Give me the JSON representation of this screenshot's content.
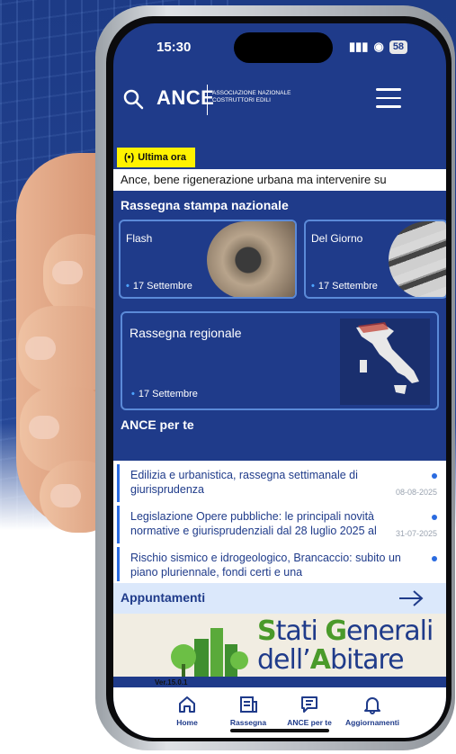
{
  "status_bar": {
    "time": "15:30",
    "signal": "▐▌",
    "battery": "58"
  },
  "header": {
    "logo": "ANCE",
    "logo_sub": "ASSOCIAZIONE NAZIONALE COSTRUTTORI EDILI",
    "icons": [
      "search-icon",
      "hamburger-menu-icon"
    ]
  },
  "breaking": {
    "badge_icon": "(•)",
    "badge_label": "Ultima ora",
    "ticker_text": "Ance, bene rigenerazione urbana ma intervenire su"
  },
  "rassegna": {
    "title": "Rassegna stampa nazionale",
    "cards": [
      {
        "label": "Flash",
        "date": "17 Settembre"
      },
      {
        "label": "Del Giorno",
        "date": "17 Settembre"
      }
    ],
    "regional": {
      "label": "Rassegna regionale",
      "date": "17 Settembre"
    }
  },
  "ance_per_te": {
    "title": "ANCE per te",
    "items": [
      {
        "text": "Edilizia e urbanistica, rassegna settimanale di giurisprudenza",
        "date": "08-08-2025"
      },
      {
        "text": "Legislazione Opere pubbliche: le principali novità normative e giurisprudenziali dal 28 luglio 2025 al",
        "date": "31-07-2025"
      },
      {
        "text": "Rischio sismico e idrogeologico, Brancaccio: subito un piano pluriennale, fondi certi e una",
        "date": ""
      }
    ]
  },
  "appuntamenti": {
    "title": "Appuntamenti",
    "icon": "arrow-right-icon"
  },
  "banner": {
    "line1_a": "S",
    "line1_b": "tati ",
    "line1_c": "G",
    "line1_d": "enerali",
    "line2_a": "dell’",
    "line2_b": "A",
    "line2_c": "bitare"
  },
  "version": "Ver.15.0.1",
  "nav": [
    {
      "label": "Home",
      "icon": "home-icon"
    },
    {
      "label": "Rassegna",
      "icon": "newspaper-icon"
    },
    {
      "label": "ANCE per te",
      "icon": "message-icon"
    },
    {
      "label": "Aggiornamenti",
      "icon": "bell-icon"
    }
  ],
  "colors": {
    "primary": "#1f3b8a",
    "accent": "#2a6be0",
    "badge": "#fff200",
    "green": "#4a9a2a"
  }
}
